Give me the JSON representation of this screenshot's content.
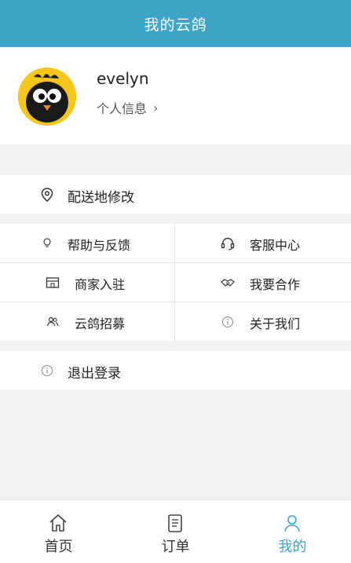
{
  "header": {
    "title": "我的云鸽"
  },
  "profile": {
    "username": "evelyn",
    "info_link": "个人信息",
    "chevron": "›"
  },
  "address": {
    "label": "配送地修改"
  },
  "grid": {
    "help": "帮助与反馈",
    "service": "客服中心",
    "merchant": "商家入驻",
    "cooperate": "我要合作",
    "recruit": "云鸽招募",
    "about": "关于我们"
  },
  "logout": {
    "label": "退出登录"
  },
  "tabs": [
    {
      "label": "首页",
      "icon": "home-icon"
    },
    {
      "label": "订单",
      "icon": "order-icon"
    },
    {
      "label": "我的",
      "icon": "user-icon",
      "active": true
    }
  ],
  "colors": {
    "accent": "#3ea5c8",
    "avatar_bg": "#f6c71a"
  }
}
